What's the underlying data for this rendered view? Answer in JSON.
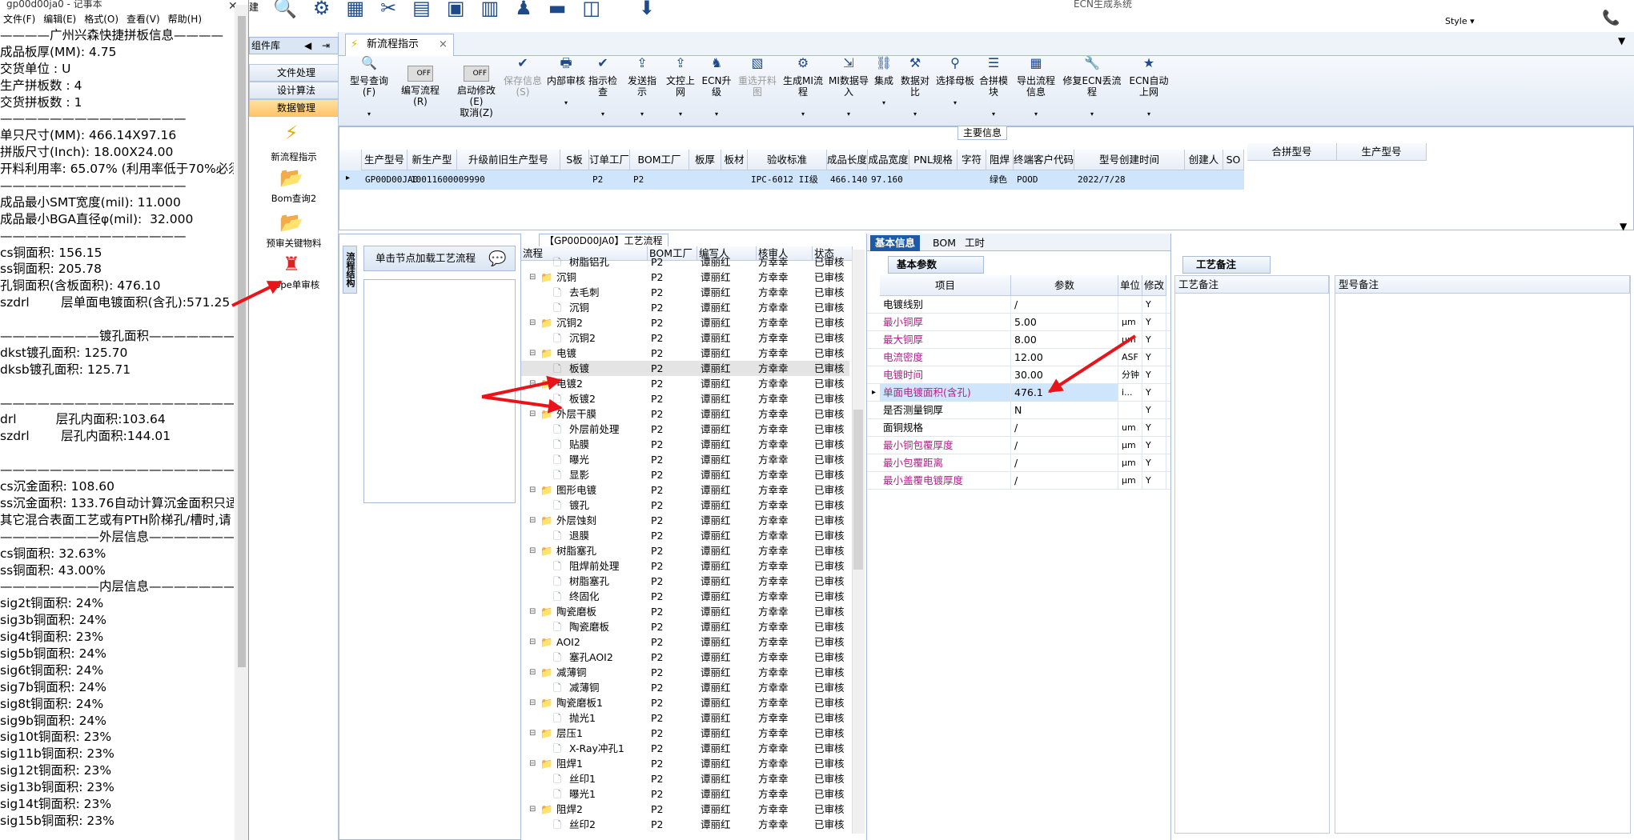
{
  "notepad": {
    "title": "gp00d00ja0 - 记事本",
    "menu": [
      "文件(F)",
      "编辑(E)",
      "格式(O)",
      "查看(V)",
      "帮助(H)"
    ],
    "lines": [
      "————广州兴森快捷拼板信息————",
      "成品板厚(MM): 4.75",
      "交货单位 : U",
      "生产拼板数 : 4",
      "交货拼板数 : 1",
      "———————————————",
      "单只尺寸(MM): 466.14X97.16",
      "拼版尺寸(Inch): 18.00X24.00",
      "开料利用率: 65.07% (利用率低于70%必须",
      "———————————————",
      "成品最小SMT宽度(mil): 11.000",
      "成品最小BGA直径φ(mil):  32.000",
      "———————————————",
      "cs铜面积: 156.15",
      "ss铜面积: 205.78",
      "孔铜面积(含板面积): 476.10",
      "szdrl        层单面电镀面积(含孔):571.25",
      "",
      "————————镀孔面积————————",
      "dkst镀孔面积: 125.70",
      "dksb镀孔面积: 125.71",
      "",
      "—————————————————————",
      "drl          层孔内面积:103.64",
      "szdrl        层孔内面积:144.01",
      "",
      "—————————————————————",
      "cs沉金面积: 108.60",
      "ss沉金面积: 133.76自动计算沉金面积只适",
      "其它混合表面工艺或有PTH阶梯孔/槽时,请",
      "————————外层信息————————",
      "cs铜面积: 32.63%",
      "ss铜面积: 43.00%",
      "————————内层信息————————",
      "sig2t铜面积: 24%",
      "sig3b铜面积: 24%",
      "sig4t铜面积: 23%",
      "sig5b铜面积: 24%",
      "sig6t铜面积: 24%",
      "sig7b铜面积: 24%",
      "sig8t铜面积: 24%",
      "sig9b铜面积: 24%",
      "sig10t铜面积: 23%",
      "sig11b铜面积: 23%",
      "sig12t铜面积: 23%",
      "sig13b铜面积: 23%",
      "sig14t铜面积: 23%",
      "sig15b铜面积: 23%"
    ]
  },
  "toolbox": {
    "header": "组件库",
    "rows": [
      "文件处理",
      "设计算法",
      "数据管理"
    ],
    "tools": [
      "新流程指示",
      "Bom查询2",
      "预审关键物料",
      "Nope单审核"
    ]
  },
  "window": {
    "center_title": "ECN生成系统",
    "style_label": "Style ▾"
  },
  "tab": {
    "label": "新流程指示"
  },
  "ribbon": {
    "buttons": [
      {
        "label": "型号查询(F)",
        "icon": "search-icon"
      },
      {
        "label": "编写流程(R)",
        "icon": "toggle-icon",
        "toggle": "OFF"
      },
      {
        "label": "启动修改(E)",
        "sub": "取消(Z)",
        "icon": "toggle-icon",
        "toggle": "OFF"
      },
      {
        "label": "保存信息(S)",
        "icon": "check-icon"
      },
      {
        "label": "内部审核",
        "icon": "print-icon"
      },
      {
        "label": "指示检查",
        "icon": "check-icon"
      },
      {
        "label": "发送指示",
        "icon": "upload-icon"
      },
      {
        "label": "文控上网",
        "icon": "upload-icon"
      },
      {
        "label": "ECN升级",
        "icon": "person-icon"
      },
      {
        "label": "重选开料图",
        "icon": "image-icon"
      },
      {
        "label": "生成MI流程",
        "icon": "gear-icon"
      },
      {
        "label": "MI数据导入",
        "icon": "import-icon"
      },
      {
        "label": "集成",
        "icon": "link-icon"
      },
      {
        "label": "数据对比",
        "icon": "tool-icon"
      },
      {
        "label": "选择母板",
        "icon": "filter-icon"
      },
      {
        "label": "合拼模块",
        "icon": "list-icon"
      },
      {
        "label": "导出流程信息",
        "icon": "grid-icon"
      },
      {
        "label": "修复ECN丢流程",
        "icon": "wrench-icon"
      },
      {
        "label": "ECN自动上网",
        "icon": "star-icon"
      }
    ]
  },
  "main_grid": {
    "group_label": "主要信息",
    "columns": [
      "生产型号",
      "新生产型号",
      "升级前旧生产型号",
      "S板",
      "订单工厂",
      "BOM工厂",
      "板厚",
      "板材",
      "验收标准",
      "成品长度",
      "成品宽度",
      "PNL规格",
      "字符",
      "阻焊",
      "终端客户代码",
      "型号创建时间",
      "创建人",
      "SO"
    ],
    "row": [
      "GP00D00JA0",
      "10011600009990",
      "",
      "",
      "P2",
      "P2",
      "",
      "",
      "IPC-6012 II级",
      "466.140",
      "97.160",
      "",
      "",
      "绿色",
      "POOD",
      "2022/7/28",
      "",
      ""
    ],
    "right_columns": [
      "合拼型号",
      "生产型号"
    ]
  },
  "flow_panel": {
    "side_label": "流程结构",
    "load_hint": "单击节点加载工艺流程",
    "group_label": "【GP00D00JA0】工艺流程",
    "columns": [
      "流程",
      "BOM工厂",
      "编写人",
      "核审人",
      "状态"
    ],
    "rows": [
      {
        "level": 2,
        "name": "树脂铝孔",
        "factory": "P2",
        "writer": "谭丽红",
        "checker": "方幸幸",
        "status": "已审核"
      },
      {
        "level": 1,
        "name": "沉铜",
        "factory": "P2",
        "writer": "谭丽红",
        "checker": "方幸幸",
        "status": "已审核"
      },
      {
        "level": 2,
        "name": "去毛刺",
        "factory": "P2",
        "writer": "谭丽红",
        "checker": "方幸幸",
        "status": "已审核"
      },
      {
        "level": 2,
        "name": "沉铜",
        "factory": "P2",
        "writer": "谭丽红",
        "checker": "方幸幸",
        "status": "已审核"
      },
      {
        "level": 1,
        "name": "沉铜2",
        "factory": "P2",
        "writer": "谭丽红",
        "checker": "方幸幸",
        "status": "已审核"
      },
      {
        "level": 2,
        "name": "沉铜2",
        "factory": "P2",
        "writer": "谭丽红",
        "checker": "方幸幸",
        "status": "已审核"
      },
      {
        "level": 1,
        "name": "电镀",
        "factory": "P2",
        "writer": "谭丽红",
        "checker": "方幸幸",
        "status": "已审核"
      },
      {
        "level": 2,
        "name": "板镀",
        "factory": "P2",
        "writer": "谭丽红",
        "checker": "方幸幸",
        "status": "已审核"
      },
      {
        "level": 1,
        "name": "电镀2",
        "factory": "P2",
        "writer": "谭丽红",
        "checker": "方幸幸",
        "status": "已审核"
      },
      {
        "level": 2,
        "name": "板镀2",
        "factory": "P2",
        "writer": "谭丽红",
        "checker": "方幸幸",
        "status": "已审核"
      },
      {
        "level": 1,
        "name": "外层干膜",
        "factory": "P2",
        "writer": "谭丽红",
        "checker": "方幸幸",
        "status": "已审核"
      },
      {
        "level": 2,
        "name": "外层前处理",
        "factory": "P2",
        "writer": "谭丽红",
        "checker": "方幸幸",
        "status": "已审核"
      },
      {
        "level": 2,
        "name": "贴膜",
        "factory": "P2",
        "writer": "谭丽红",
        "checker": "方幸幸",
        "status": "已审核"
      },
      {
        "level": 2,
        "name": "曝光",
        "factory": "P2",
        "writer": "谭丽红",
        "checker": "方幸幸",
        "status": "已审核"
      },
      {
        "level": 2,
        "name": "显影",
        "factory": "P2",
        "writer": "谭丽红",
        "checker": "方幸幸",
        "status": "已审核"
      },
      {
        "level": 1,
        "name": "图形电镀",
        "factory": "P2",
        "writer": "谭丽红",
        "checker": "方幸幸",
        "status": "已审核"
      },
      {
        "level": 2,
        "name": "镀孔",
        "factory": "P2",
        "writer": "谭丽红",
        "checker": "方幸幸",
        "status": "已审核"
      },
      {
        "level": 1,
        "name": "外层蚀刻",
        "factory": "P2",
        "writer": "谭丽红",
        "checker": "方幸幸",
        "status": "已审核"
      },
      {
        "level": 2,
        "name": "退膜",
        "factory": "P2",
        "writer": "谭丽红",
        "checker": "方幸幸",
        "status": "已审核"
      },
      {
        "level": 1,
        "name": "树脂塞孔",
        "factory": "P2",
        "writer": "谭丽红",
        "checker": "方幸幸",
        "status": "已审核"
      },
      {
        "level": 2,
        "name": "阻焊前处理",
        "factory": "P2",
        "writer": "谭丽红",
        "checker": "方幸幸",
        "status": "已审核"
      },
      {
        "level": 2,
        "name": "树脂塞孔",
        "factory": "P2",
        "writer": "谭丽红",
        "checker": "方幸幸",
        "status": "已审核"
      },
      {
        "level": 2,
        "name": "终固化",
        "factory": "P2",
        "writer": "谭丽红",
        "checker": "方幸幸",
        "status": "已审核"
      },
      {
        "level": 1,
        "name": "陶瓷磨板",
        "factory": "P2",
        "writer": "谭丽红",
        "checker": "方幸幸",
        "status": "已审核"
      },
      {
        "level": 2,
        "name": "陶瓷磨板",
        "factory": "P2",
        "writer": "谭丽红",
        "checker": "方幸幸",
        "status": "已审核"
      },
      {
        "level": 1,
        "name": "AOI2",
        "factory": "P2",
        "writer": "谭丽红",
        "checker": "方幸幸",
        "status": "已审核"
      },
      {
        "level": 2,
        "name": "塞孔AOI2",
        "factory": "P2",
        "writer": "谭丽红",
        "checker": "方幸幸",
        "status": "已审核"
      },
      {
        "level": 1,
        "name": "减薄铜",
        "factory": "P2",
        "writer": "谭丽红",
        "checker": "方幸幸",
        "status": "已审核"
      },
      {
        "level": 2,
        "name": "减薄铜",
        "factory": "P2",
        "writer": "谭丽红",
        "checker": "方幸幸",
        "status": "已审核"
      },
      {
        "level": 1,
        "name": "陶瓷磨板1",
        "factory": "P2",
        "writer": "谭丽红",
        "checker": "方幸幸",
        "status": "已审核"
      },
      {
        "level": 2,
        "name": "抛光1",
        "factory": "P2",
        "writer": "谭丽红",
        "checker": "方幸幸",
        "status": "已审核"
      },
      {
        "level": 1,
        "name": "层压1",
        "factory": "P2",
        "writer": "谭丽红",
        "checker": "方幸幸",
        "status": "已审核"
      },
      {
        "level": 2,
        "name": "X-Ray冲孔1",
        "factory": "P2",
        "writer": "谭丽红",
        "checker": "方幸幸",
        "status": "已审核"
      },
      {
        "level": 1,
        "name": "阻焊1",
        "factory": "P2",
        "writer": "谭丽红",
        "checker": "方幸幸",
        "status": "已审核"
      },
      {
        "level": 2,
        "name": "丝印1",
        "factory": "P2",
        "writer": "谭丽红",
        "checker": "方幸幸",
        "status": "已审核"
      },
      {
        "level": 2,
        "name": "曝光1",
        "factory": "P2",
        "writer": "谭丽红",
        "checker": "方幸幸",
        "status": "已审核"
      },
      {
        "level": 1,
        "name": "阻焊2",
        "factory": "P2",
        "writer": "谭丽红",
        "checker": "方幸幸",
        "status": "已审核"
      },
      {
        "level": 2,
        "name": "丝印2",
        "factory": "P2",
        "writer": "谭丽红",
        "checker": "方幸幸",
        "status": "已审核"
      }
    ]
  },
  "params_panel": {
    "tabs": [
      "基本信息",
      "BOM",
      "工时"
    ],
    "subtab": "基本参数",
    "columns": [
      "项目",
      "参数",
      "单位",
      "修改"
    ],
    "rows": [
      {
        "item": "电镀线别",
        "value": "/",
        "unit": "",
        "mod": "Y",
        "pink": false
      },
      {
        "item": "最小铜厚",
        "value": "5.00",
        "unit": "μm",
        "mod": "Y",
        "pink": true
      },
      {
        "item": "最大铜厚",
        "value": "8.00",
        "unit": "μm",
        "mod": "Y",
        "pink": true
      },
      {
        "item": "电流密度",
        "value": "12.00",
        "unit": "ASF",
        "mod": "Y",
        "pink": true
      },
      {
        "item": "电镀时间",
        "value": "30.00",
        "unit": "分钟",
        "mod": "Y",
        "pink": true
      },
      {
        "item": "单面电镀面积(含孔)",
        "value": "476.1",
        "unit": "i...",
        "mod": "Y",
        "pink": true,
        "selected": true
      },
      {
        "item": "是否测量铜厚",
        "value": "N",
        "unit": "",
        "mod": "Y",
        "pink": false
      },
      {
        "item": "面铜规格",
        "value": "/",
        "unit": "um",
        "mod": "Y",
        "pink": false
      },
      {
        "item": "最小铜包覆厚度",
        "value": "/",
        "unit": "μm",
        "mod": "Y",
        "pink": true
      },
      {
        "item": "最小包覆距离",
        "value": "/",
        "unit": "μm",
        "mod": "Y",
        "pink": true
      },
      {
        "item": "最小盖覆电镀厚度",
        "value": "/",
        "unit": "μm",
        "mod": "Y",
        "pink": true
      }
    ]
  },
  "remarks_panel": {
    "tab": "工艺备注",
    "col1": "工艺备注",
    "col2": "型号备注"
  },
  "colors": {
    "accent_blue": "#1e5aa8",
    "selected_row": "#cfe5fb",
    "pink_text": "#b0208a",
    "arrow_red": "#e8141a",
    "orange_selected": "#ffc46a"
  }
}
